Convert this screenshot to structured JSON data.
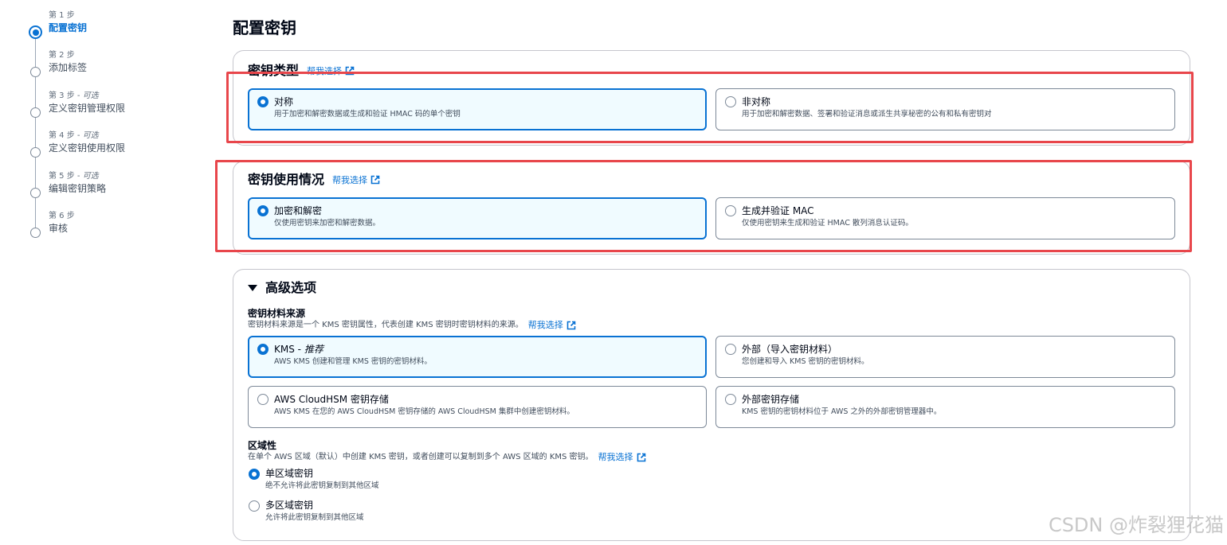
{
  "steps": [
    {
      "number": "第 1 步",
      "optional": "",
      "title": "配置密钥",
      "active": true
    },
    {
      "number": "第 2 步",
      "optional": "",
      "title": "添加标签",
      "active": false
    },
    {
      "number": "第 3 步 - ",
      "optional": "可选",
      "title": "定义密钥管理权限",
      "active": false
    },
    {
      "number": "第 4 步 - ",
      "optional": "可选",
      "title": "定义密钥使用权限",
      "active": false
    },
    {
      "number": "第 5 步 - ",
      "optional": "可选",
      "title": "编辑密钥策略",
      "active": false
    },
    {
      "number": "第 6 步",
      "optional": "",
      "title": "审核",
      "active": false
    }
  ],
  "page_title": "配置密钥",
  "help_link": "帮我选择",
  "key_type": {
    "heading": "密钥类型",
    "options": [
      {
        "title": "对称",
        "desc": "用于加密和解密数据或生成和验证 HMAC 码的单个密钥",
        "selected": true
      },
      {
        "title": "非对称",
        "desc": "用于加密和解密数据、签署和验证消息或派生共享秘密的公有和私有密钥对",
        "selected": false
      }
    ]
  },
  "key_usage": {
    "heading": "密钥使用情况",
    "options": [
      {
        "title": "加密和解密",
        "desc": "仅使用密钥来加密和解密数据。",
        "selected": true
      },
      {
        "title": "生成并验证 MAC",
        "desc": "仅使用密钥来生成和验证 HMAC 散列消息认证码。",
        "selected": false
      }
    ]
  },
  "advanced": {
    "heading": "高级选项",
    "material": {
      "label": "密钥材料来源",
      "desc": "密钥材料来源是一个 KMS 密钥属性，代表创建 KMS 密钥时密钥材料的来源。",
      "options": [
        {
          "title": "KMS - ",
          "title_em": "推荐",
          "desc": "AWS KMS 创建和管理 KMS 密钥的密钥材料。",
          "selected": true
        },
        {
          "title": "外部（导入密钥材料）",
          "title_em": "",
          "desc": "您创建和导入 KMS 密钥的密钥材料。",
          "selected": false
        },
        {
          "title": "AWS CloudHSM 密钥存储",
          "title_em": "",
          "desc": "AWS KMS 在您的 AWS CloudHSM 密钥存储的 AWS CloudHSM 集群中创建密钥材料。",
          "selected": false
        },
        {
          "title": "外部密钥存储",
          "title_em": "",
          "desc": "KMS 密钥的密钥材料位于 AWS 之外的外部密钥管理器中。",
          "selected": false
        }
      ]
    },
    "region": {
      "label": "区域性",
      "desc": "在单个 AWS 区域（默认）中创建 KMS 密钥，或者创建可以复制到多个 AWS 区域的 KMS 密钥。",
      "options": [
        {
          "title": "单区域密钥",
          "desc": "绝不允许将此密钥复制到其他区域",
          "selected": true
        },
        {
          "title": "多区域密钥",
          "desc": "允许将此密钥复制到其他区域",
          "selected": false
        }
      ]
    }
  },
  "highlight_color": "#e8464b",
  "accent_color": "#0972d3",
  "watermark": "CSDN @炸裂狸花猫"
}
